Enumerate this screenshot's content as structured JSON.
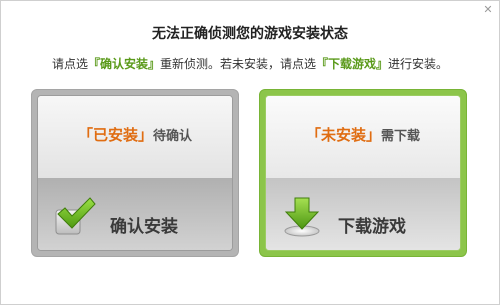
{
  "dialog": {
    "title": "无法正确侦测您的游戏安装状态",
    "close_icon": "close-icon",
    "instruction": {
      "part1": "请点选",
      "highlight1": "『确认安装』",
      "part2": "重新侦测。若未安装，请点选",
      "highlight2": "『下载游戏』",
      "part3": "进行安装。"
    }
  },
  "panels": {
    "installed": {
      "status_label": "「已安装」",
      "status_suffix": "待确认",
      "action_label": "确认安装",
      "icon": "checkmark-icon"
    },
    "not_installed": {
      "status_label": "「未安装」",
      "status_suffix": "需下载",
      "action_label": "下载游戏",
      "icon": "download-arrow-icon"
    }
  },
  "colors": {
    "highlight_green": "#5a9a1a",
    "status_orange": "#e06d12",
    "panel_green_border": "#8cc54a",
    "panel_gray_border": "#b4b4b4"
  }
}
